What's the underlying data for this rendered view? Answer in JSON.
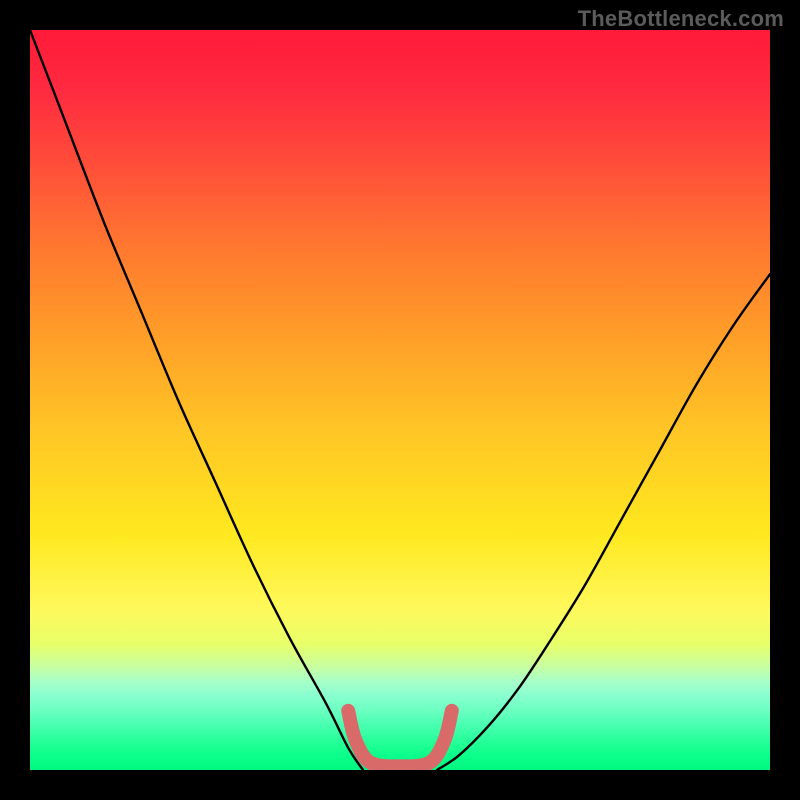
{
  "watermark": "TheBottleneck.com",
  "chart_data": {
    "type": "line",
    "title": "",
    "xlabel": "",
    "ylabel": "",
    "xlim": [
      0,
      100
    ],
    "ylim": [
      0,
      100
    ],
    "series": [
      {
        "name": "left-curve",
        "x": [
          0,
          5,
          10,
          15,
          20,
          25,
          30,
          35,
          40,
          43,
          45
        ],
        "y": [
          100,
          87,
          74,
          62,
          50,
          39,
          28,
          18,
          9,
          3,
          0
        ]
      },
      {
        "name": "right-curve",
        "x": [
          55,
          58,
          62,
          66,
          70,
          75,
          80,
          85,
          90,
          95,
          100
        ],
        "y": [
          0,
          2,
          6,
          11,
          17,
          25,
          34,
          43,
          52,
          60,
          67
        ]
      },
      {
        "name": "trough-highlight",
        "x": [
          43,
          44,
          46,
          50,
          54,
          56,
          57
        ],
        "y": [
          8,
          4,
          1,
          0.5,
          1,
          4,
          8
        ]
      }
    ],
    "notes": "V-shaped bottleneck curve on rainbow gradient; trough between x≈43 and x≈57 highlighted with thick salmon stroke; background gradient red→yellow→green top to bottom."
  }
}
